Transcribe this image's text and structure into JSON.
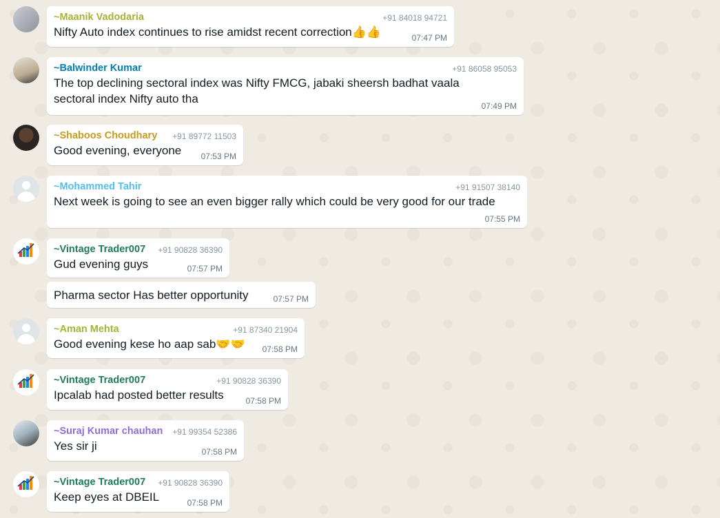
{
  "messages": [
    {
      "sender": "~Maanik Vadodaria",
      "phone": "+91 84018 94721",
      "text": "Nifty Auto index continues to rise amidst recent correction👍👍",
      "time": "07:47 PM",
      "color": "#a5b337"
    },
    {
      "sender": "~Balwinder Kumar",
      "phone": "+91 86058 95053",
      "text": "The top declining sectoral index was Nifty FMCG, jabaki sheersh badhat vaala sectoral index Nifty auto tha",
      "time": "07:49 PM",
      "color": "#027eb5"
    },
    {
      "sender": "~Shaboos Choudhary",
      "phone": "+91 89772 11503",
      "text": "Good evening, everyone",
      "time": "07:53 PM",
      "color": "#c79b1c"
    },
    {
      "sender": "~Mohammed Tahir",
      "phone": "+91 91507 38140",
      "text": "Next week is going to see an even bigger rally which could be very good for our trade",
      "time": "07:55 PM",
      "color": "#53bdeb"
    },
    {
      "sender": "~Vintage Trader007",
      "phone": "+91 90828 36390",
      "text": "Gud evening guys",
      "time": "07:57 PM",
      "color": "#1f7a5c"
    },
    {
      "sender": "",
      "phone": "",
      "text": "Pharma sector Has better opportunity",
      "time": "07:57 PM",
      "color": ""
    },
    {
      "sender": "~Aman Mehta",
      "phone": "+91 87340 21904",
      "text": "Good evening kese ho aap sab🤝🤝",
      "time": "07:58 PM",
      "color": "#a5b337"
    },
    {
      "sender": "~Vintage Trader007",
      "phone": "+91 90828 36390",
      "text": "Ipcalab had posted better results",
      "time": "07:58 PM",
      "color": "#1f7a5c"
    },
    {
      "sender": "~Suraj Kumar chauhan",
      "phone": "+91 99354 52386",
      "text": "Yes sir ji",
      "time": "07:58 PM",
      "color": "#8b6fd6"
    },
    {
      "sender": "~Vintage Trader007",
      "phone": "+91 90828 36390",
      "text": "Keep eyes at DBEIL",
      "time": "07:58 PM",
      "color": "#1f7a5c"
    }
  ],
  "logo_text": "Vintage Trader"
}
